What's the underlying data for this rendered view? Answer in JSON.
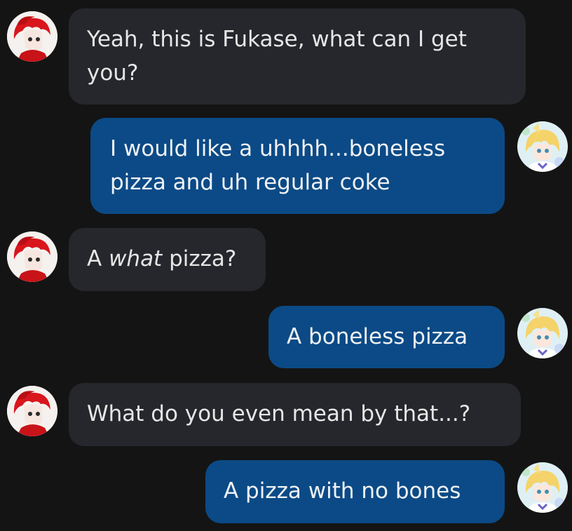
{
  "conversation": {
    "participants": {
      "left": {
        "avatar_icon": "red-haired-character-avatar-icon"
      },
      "right": {
        "avatar_icon": "blonde-character-avatar-icon"
      }
    },
    "messages": [
      {
        "side": "left",
        "lines": [
          "Yeah, this is Fukase, what can I get",
          "you?"
        ]
      },
      {
        "side": "right",
        "lines": [
          "I would like a uhhhh...boneless",
          "pizza and uh regular coke"
        ]
      },
      {
        "side": "left",
        "prefix": "A ",
        "emphasis": "what",
        "suffix": " pizza?"
      },
      {
        "side": "right",
        "lines": [
          "A boneless pizza"
        ]
      },
      {
        "side": "left",
        "lines": [
          "What do you even mean by that...?"
        ]
      },
      {
        "side": "right",
        "lines": [
          "A pizza with no bones"
        ]
      }
    ]
  },
  "colors": {
    "background": "#141414",
    "incoming_bubble": "#25272c",
    "outgoing_bubble": "#0b4a86",
    "text": "#e6e6e6"
  }
}
